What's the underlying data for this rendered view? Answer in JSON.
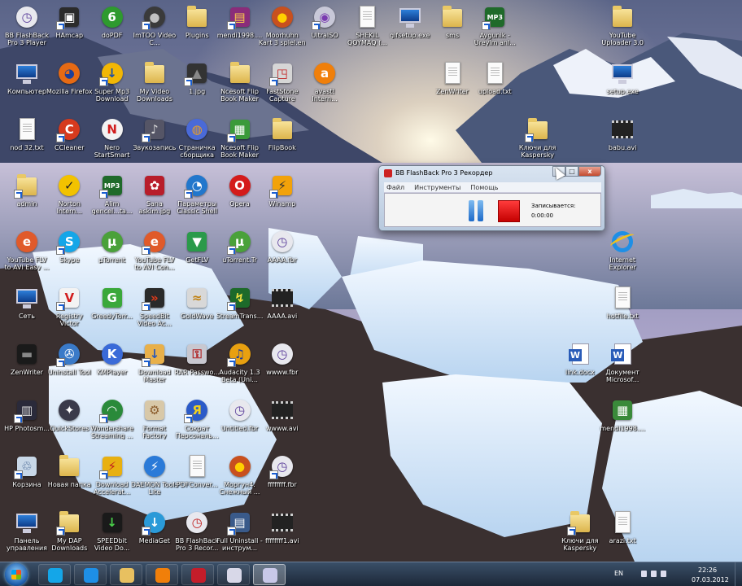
{
  "desktop": {
    "icons": [
      {
        "label": "BB FlashBack Pro 3 Player",
        "shape": "circle",
        "color": "#e8e8ee",
        "glyph": "◷",
        "gc": "#5a3d9a",
        "col": 0,
        "row": 0
      },
      {
        "label": "HAmcap",
        "shape": "square",
        "color": "#2b2b2b",
        "glyph": "▣",
        "gc": "#ffffff",
        "col": 1,
        "row": 0
      },
      {
        "label": "doPDF",
        "shape": "circle",
        "color": "#2e9a2e",
        "glyph": "6",
        "gc": "#ffffff",
        "col": 2,
        "row": 0
      },
      {
        "label": "ImTOO Video C...",
        "shape": "circle",
        "color": "#3a3a3a",
        "glyph": "●",
        "gc": "#c0c0c0",
        "col": 3,
        "row": 0
      },
      {
        "label": "Plugins",
        "shape": "folder",
        "col": 4,
        "row": 0
      },
      {
        "label": "mendi1998....",
        "shape": "square",
        "color": "#8a2c7a",
        "glyph": "▤",
        "gc": "#ffd24a",
        "col": 5,
        "row": 0
      },
      {
        "label": "Moorhuhn Kart 3 spiel.en",
        "shape": "circle",
        "color": "#c8501e",
        "glyph": "●",
        "gc": "#ffd000",
        "col": 6,
        "row": 0
      },
      {
        "label": "UltraISO",
        "shape": "circle",
        "color": "#c8c8d8",
        "glyph": "◉",
        "gc": "#7a3ab0",
        "col": 7,
        "row": 0
      },
      {
        "label": "SHEKIL QOYMAQ (...",
        "shape": "doc",
        "col": 8,
        "row": 0
      },
      {
        "label": "gifsetup.exe",
        "shape": "screen",
        "col": 9,
        "row": 0
      },
      {
        "label": "sms",
        "shape": "folder",
        "col": 10,
        "row": 0
      },
      {
        "label": "Aygunik - Ureyim anl...",
        "shape": "square",
        "color": "#1f6a2a",
        "glyph": "MP3",
        "gc": "#ffffff",
        "col": 11,
        "row": 0
      },
      {
        "label": "YouTube Uploader 3.0",
        "shape": "folder",
        "col": 14,
        "row": 0
      },
      {
        "label": "Компьютер",
        "shape": "screen",
        "col": 0,
        "row": 1
      },
      {
        "label": "Mozilla Firefox",
        "shape": "circle",
        "color": "#e66a14",
        "glyph": "◕",
        "gc": "#1b3f9a",
        "col": 1,
        "row": 1
      },
      {
        "label": "Super Mp3 Download",
        "shape": "circle",
        "color": "#f2b705",
        "glyph": "↓",
        "gc": "#1a4ea8",
        "col": 2,
        "row": 1
      },
      {
        "label": "My Video Downloads",
        "shape": "folder",
        "col": 3,
        "row": 1
      },
      {
        "label": "1.jpg",
        "shape": "square",
        "color": "#333333",
        "glyph": "▲",
        "gc": "#888888",
        "col": 4,
        "row": 1
      },
      {
        "label": "Ncesoft Flip Book Maker",
        "shape": "folder",
        "col": 5,
        "row": 1
      },
      {
        "label": "FastStone Capture",
        "shape": "square",
        "color": "#d6d6d6",
        "glyph": "◳",
        "gc": "#c21f1f",
        "col": 6,
        "row": 1
      },
      {
        "label": "avast! Intern...",
        "shape": "circle",
        "color": "#f07f0a",
        "glyph": "a",
        "gc": "#ffffff",
        "col": 7,
        "row": 1
      },
      {
        "label": "ZenWriter",
        "shape": "doc",
        "col": 10,
        "row": 1
      },
      {
        "label": "upload.txt",
        "shape": "doc",
        "col": 11,
        "row": 1
      },
      {
        "label": "setup.exe",
        "shape": "screen",
        "col": 14,
        "row": 1
      },
      {
        "label": "nod 32.txt",
        "shape": "doc",
        "col": 0,
        "row": 2
      },
      {
        "label": "CCleaner",
        "shape": "circle",
        "color": "#d63a1e",
        "glyph": "C",
        "gc": "#ffffff",
        "col": 1,
        "row": 2
      },
      {
        "label": "Nero StartSmart",
        "shape": "circle",
        "color": "#f3f3f3",
        "glyph": "N",
        "gc": "#d11d1d",
        "col": 2,
        "row": 2
      },
      {
        "label": "Звукозапись",
        "shape": "square",
        "color": "#555566",
        "glyph": "♪",
        "gc": "#dddddd",
        "col": 3,
        "row": 2
      },
      {
        "label": "Страничка сборщика",
        "shape": "circle",
        "color": "#4a6ad8",
        "glyph": "◍",
        "gc": "#f0a020",
        "col": 4,
        "row": 2
      },
      {
        "label": "Ncesoft Flip Book Maker",
        "shape": "square",
        "color": "#3a9a3a",
        "glyph": "▦",
        "gc": "#ffffff",
        "col": 5,
        "row": 2
      },
      {
        "label": "FlipBook",
        "shape": "folder",
        "col": 6,
        "row": 2
      },
      {
        "label": "Ключи для Kaspersky",
        "shape": "folder",
        "col": 12,
        "row": 2
      },
      {
        "label": "babu.avi",
        "shape": "film",
        "col": 14,
        "row": 2
      },
      {
        "label": "admin",
        "shape": "folder",
        "col": 0,
        "row": 3
      },
      {
        "label": "Norton Intern...",
        "shape": "circle",
        "color": "#f2c200",
        "glyph": "✓",
        "gc": "#222222",
        "col": 1,
        "row": 3
      },
      {
        "label": "Alim gencel...ta...",
        "shape": "square",
        "color": "#1f6a2a",
        "glyph": "MP3",
        "gc": "#ffffff",
        "col": 2,
        "row": 3
      },
      {
        "label": "Sana askim.jpg",
        "shape": "square",
        "color": "#b81d2a",
        "glyph": "✿",
        "gc": "#ffffff",
        "col": 3,
        "row": 3
      },
      {
        "label": "Параметры Classic Shell",
        "shape": "circle",
        "color": "#2277cc",
        "glyph": "◔",
        "gc": "#ffffff",
        "col": 4,
        "row": 3
      },
      {
        "label": "Opera",
        "shape": "circle",
        "color": "#d41b1b",
        "glyph": "O",
        "gc": "#ffffff",
        "col": 5,
        "row": 3
      },
      {
        "label": "Winamp",
        "shape": "square",
        "color": "#f2a20a",
        "glyph": "⚡",
        "gc": "#333333",
        "col": 6,
        "row": 3
      },
      {
        "label": "YouTube FLV to AVI Easy ...",
        "shape": "circle",
        "color": "#e05a2a",
        "glyph": "e",
        "gc": "#ffffff",
        "col": 0,
        "row": 4
      },
      {
        "label": "Skype",
        "shape": "circle",
        "color": "#14a6e8",
        "glyph": "S",
        "gc": "#ffffff",
        "col": 1,
        "row": 4
      },
      {
        "label": "µTorrent",
        "shape": "circle",
        "color": "#4aa13a",
        "glyph": "µ",
        "gc": "#ffffff",
        "col": 2,
        "row": 4
      },
      {
        "label": "YouTube FLV to AVI Con...",
        "shape": "circle",
        "color": "#e05a2a",
        "glyph": "e",
        "gc": "#ffffff",
        "col": 3,
        "row": 4
      },
      {
        "label": "GetFLV",
        "shape": "square",
        "color": "#2a9a4a",
        "glyph": "▼",
        "gc": "#ffffff",
        "col": 4,
        "row": 4
      },
      {
        "label": "uTorrent.Tr",
        "shape": "circle",
        "color": "#4aa13a",
        "glyph": "µ",
        "gc": "#ffffff",
        "col": 5,
        "row": 4
      },
      {
        "label": "AAAA.fbr",
        "shape": "circle",
        "color": "#e8e8ee",
        "glyph": "◷",
        "gc": "#5a3d9a",
        "col": 6,
        "row": 4
      },
      {
        "label": "Internet Explorer",
        "shape": "ie",
        "col": 14,
        "row": 4
      },
      {
        "label": "Сеть",
        "shape": "screen",
        "col": 0,
        "row": 5
      },
      {
        "label": "Registry Victor",
        "shape": "square",
        "color": "#f3f3f3",
        "glyph": "V",
        "gc": "#d21d1d",
        "col": 1,
        "row": 5
      },
      {
        "label": "GreedyTorr...",
        "shape": "square",
        "color": "#3aa83a",
        "glyph": "G",
        "gc": "#ffffff",
        "col": 2,
        "row": 5
      },
      {
        "label": "SpeedBit Video Ac...",
        "shape": "square",
        "color": "#2a2a2a",
        "glyph": "»",
        "gc": "#e03a1a",
        "col": 3,
        "row": 5
      },
      {
        "label": "GoldWave",
        "shape": "square",
        "color": "#d8d8d8",
        "glyph": "≈",
        "gc": "#c08010",
        "col": 4,
        "row": 5
      },
      {
        "label": "StreamTrans...",
        "shape": "square",
        "color": "#1d6a2a",
        "glyph": "↯",
        "gc": "#f0e040",
        "col": 5,
        "row": 5
      },
      {
        "label": "AAAA.avi",
        "shape": "film",
        "col": 6,
        "row": 5
      },
      {
        "label": "hotfile.txt",
        "shape": "doc",
        "col": 14,
        "row": 5
      },
      {
        "label": "ZenWriter",
        "shape": "square",
        "color": "#1a1a1a",
        "glyph": "▬",
        "gc": "#888888",
        "col": 0,
        "row": 6
      },
      {
        "label": "Uninstall Tool",
        "shape": "circle",
        "color": "#3a7ac8",
        "glyph": "✇",
        "gc": "#ffffff",
        "col": 1,
        "row": 6
      },
      {
        "label": "KMPlayer",
        "shape": "circle",
        "color": "#3a6ad8",
        "glyph": "K",
        "gc": "#ffffff",
        "col": 2,
        "row": 6
      },
      {
        "label": "Download Master",
        "shape": "square",
        "color": "#e8b04a",
        "glyph": "↓",
        "gc": "#2a5ab8",
        "col": 3,
        "row": 6
      },
      {
        "label": "RAR Passwo...",
        "shape": "square",
        "color": "#c8c8d0",
        "glyph": "⚿",
        "gc": "#b01d1d",
        "col": 4,
        "row": 6
      },
      {
        "label": "Audacity 1.3 Beta (Uni...",
        "shape": "circle",
        "color": "#e8a010",
        "glyph": "♫",
        "gc": "#1d3a9a",
        "col": 5,
        "row": 6
      },
      {
        "label": "wwww.fbr",
        "shape": "circle",
        "color": "#e8e8ee",
        "glyph": "◷",
        "gc": "#5a3d9a",
        "col": 6,
        "row": 6
      },
      {
        "label": "link.docx",
        "shape": "word",
        "col": 13,
        "row": 6
      },
      {
        "label": "Документ Microsof...",
        "shape": "word",
        "col": 14,
        "row": 6
      },
      {
        "label": "HP Photosm...",
        "shape": "square",
        "color": "#2a2a3a",
        "glyph": "▥",
        "gc": "#dddddd",
        "col": 0,
        "row": 7
      },
      {
        "label": "QuickStores",
        "shape": "circle",
        "color": "#3a3a4a",
        "glyph": "✦",
        "gc": "#ffffff",
        "col": 1,
        "row": 7
      },
      {
        "label": "Wondershare Streaming ...",
        "shape": "circle",
        "color": "#2a8a3a",
        "glyph": "◠",
        "gc": "#ffffff",
        "col": 2,
        "row": 7
      },
      {
        "label": "Format Factory",
        "shape": "square",
        "color": "#d8c8a8",
        "glyph": "⚙",
        "gc": "#8a5a2a",
        "col": 3,
        "row": 7
      },
      {
        "label": "Сократ Персональ...",
        "shape": "circle",
        "color": "#2a5ac8",
        "glyph": "Я",
        "gc": "#f0d020",
        "col": 4,
        "row": 7
      },
      {
        "label": "Untitled.fbr",
        "shape": "circle",
        "color": "#e8e8ee",
        "glyph": "◷",
        "gc": "#5a3d9a",
        "col": 5,
        "row": 7
      },
      {
        "label": "wwww.avi",
        "shape": "film",
        "col": 6,
        "row": 7
      },
      {
        "label": "mendi1998....",
        "shape": "square",
        "color": "#3a8a3a",
        "glyph": "▦",
        "gc": "#ffffff",
        "col": 14,
        "row": 7
      },
      {
        "label": "Корзина",
        "shape": "square",
        "color": "#c8d8e8",
        "glyph": "♲",
        "gc": "#3a5a8a",
        "col": 0,
        "row": 8
      },
      {
        "label": "Новая папка",
        "shape": "folder",
        "col": 1,
        "row": 8
      },
      {
        "label": "Download Accelerat...",
        "shape": "square",
        "color": "#e8b010",
        "glyph": "⚡",
        "gc": "#c01d1d",
        "col": 2,
        "row": 8
      },
      {
        "label": "DAEMON Tools Lite",
        "shape": "circle",
        "color": "#2a7ad8",
        "glyph": "⚡",
        "gc": "#ffffff",
        "col": 3,
        "row": 8
      },
      {
        "label": "PDFConver...",
        "shape": "doc",
        "col": 4,
        "row": 8
      },
      {
        "label": "Моргун4. Снежный ...",
        "shape": "circle",
        "color": "#c8501e",
        "glyph": "●",
        "gc": "#ffd000",
        "col": 5,
        "row": 8
      },
      {
        "label": "ffffffff.fbr",
        "shape": "circle",
        "color": "#e8e8ee",
        "glyph": "◷",
        "gc": "#5a3d9a",
        "col": 6,
        "row": 8
      },
      {
        "label": "Панель управления",
        "shape": "screen",
        "col": 0,
        "row": 9
      },
      {
        "label": "My DAP Downloads",
        "shape": "folder",
        "col": 1,
        "row": 9
      },
      {
        "label": "SPEEDbit Video Do...",
        "shape": "square",
        "color": "#1a1a1a",
        "glyph": "↓",
        "gc": "#4ad04a",
        "col": 2,
        "row": 9
      },
      {
        "label": "MediaGet",
        "shape": "circle",
        "color": "#2a9ad8",
        "glyph": "↓",
        "gc": "#ffffff",
        "col": 3,
        "row": 9
      },
      {
        "label": "BB FlashBack Pro 3 Recor...",
        "shape": "circle",
        "color": "#e8e8ee",
        "glyph": "◷",
        "gc": "#c01d1d",
        "col": 4,
        "row": 9
      },
      {
        "label": "Full Uninstall - инструм...",
        "shape": "square",
        "color": "#3a5a8a",
        "glyph": "▤",
        "gc": "#ffffff",
        "col": 5,
        "row": 9
      },
      {
        "label": "ffffffff1.avi",
        "shape": "film",
        "col": 6,
        "row": 9
      },
      {
        "label": "Ключи для Kaspersky",
        "shape": "folder",
        "col": 13,
        "row": 9
      },
      {
        "label": "arazi.txt",
        "shape": "doc",
        "col": 14,
        "row": 9
      }
    ]
  },
  "recorder": {
    "title": "BB FlashBack Pro 3 Рекордер",
    "menu": [
      "Файл",
      "Инструменты",
      "Помощь"
    ],
    "status_label": "Записывается:",
    "elapsed": "0:00:00",
    "btn_minimize": "–",
    "btn_maximize": "□",
    "btn_close": "x"
  },
  "taskbar": {
    "pinned": [
      {
        "name": "skype",
        "color": "#14a6e8"
      },
      {
        "name": "internet-explorer",
        "color": "#1e8fe6"
      },
      {
        "name": "explorer",
        "color": "#e8c060"
      },
      {
        "name": "avast",
        "color": "#f07f0a"
      },
      {
        "name": "kaspersky",
        "color": "#c41d2a"
      },
      {
        "name": "flashback-player",
        "color": "#d8d8e8"
      },
      {
        "name": "flashback-recorder",
        "color": "#c8c8e8"
      }
    ],
    "language": "EN",
    "time": "22:26",
    "date": "07.03.2012"
  }
}
